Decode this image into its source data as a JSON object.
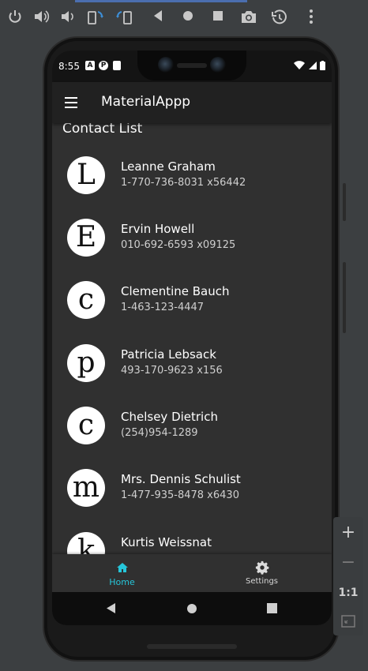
{
  "status_bar": {
    "time": "8:55",
    "icons": [
      "notification-a-icon",
      "notification-p-icon",
      "notification-card-icon"
    ],
    "right_icons": [
      "wifi-icon",
      "signal-icon",
      "battery-icon"
    ]
  },
  "app_bar": {
    "title": "MaterialAppp",
    "menu_icon": "hamburger-menu-icon"
  },
  "contact_list": {
    "header": "Contact List",
    "contacts": [
      {
        "initial": "L",
        "name": "Leanne Graham",
        "phone": "1-770-736-8031 x56442"
      },
      {
        "initial": "E",
        "name": "Ervin Howell",
        "phone": "010-692-6593 x09125"
      },
      {
        "initial": "c",
        "name": "Clementine Bauch",
        "phone": "1-463-123-4447"
      },
      {
        "initial": "p",
        "name": "Patricia Lebsack",
        "phone": "493-170-9623 x156"
      },
      {
        "initial": "c",
        "name": "Chelsey Dietrich",
        "phone": "(254)954-1289"
      },
      {
        "initial": "m",
        "name": "Mrs. Dennis Schulist",
        "phone": "1-477-935-8478 x6430"
      },
      {
        "initial": "k",
        "name": "Kurtis Weissnat",
        "phone": ""
      }
    ]
  },
  "bottom_nav": {
    "items": [
      {
        "label": "Home",
        "icon": "home-icon",
        "active": true
      },
      {
        "label": "Settings",
        "icon": "gear-icon",
        "active": false
      }
    ],
    "active_color": "#26c6da"
  },
  "emulator_controls": {
    "zoom_in": "+",
    "zoom_out": "−",
    "actual_size": "1:1"
  },
  "colors": {
    "background": "#303030",
    "app_bar": "#212121",
    "accent": "#26c6da"
  }
}
